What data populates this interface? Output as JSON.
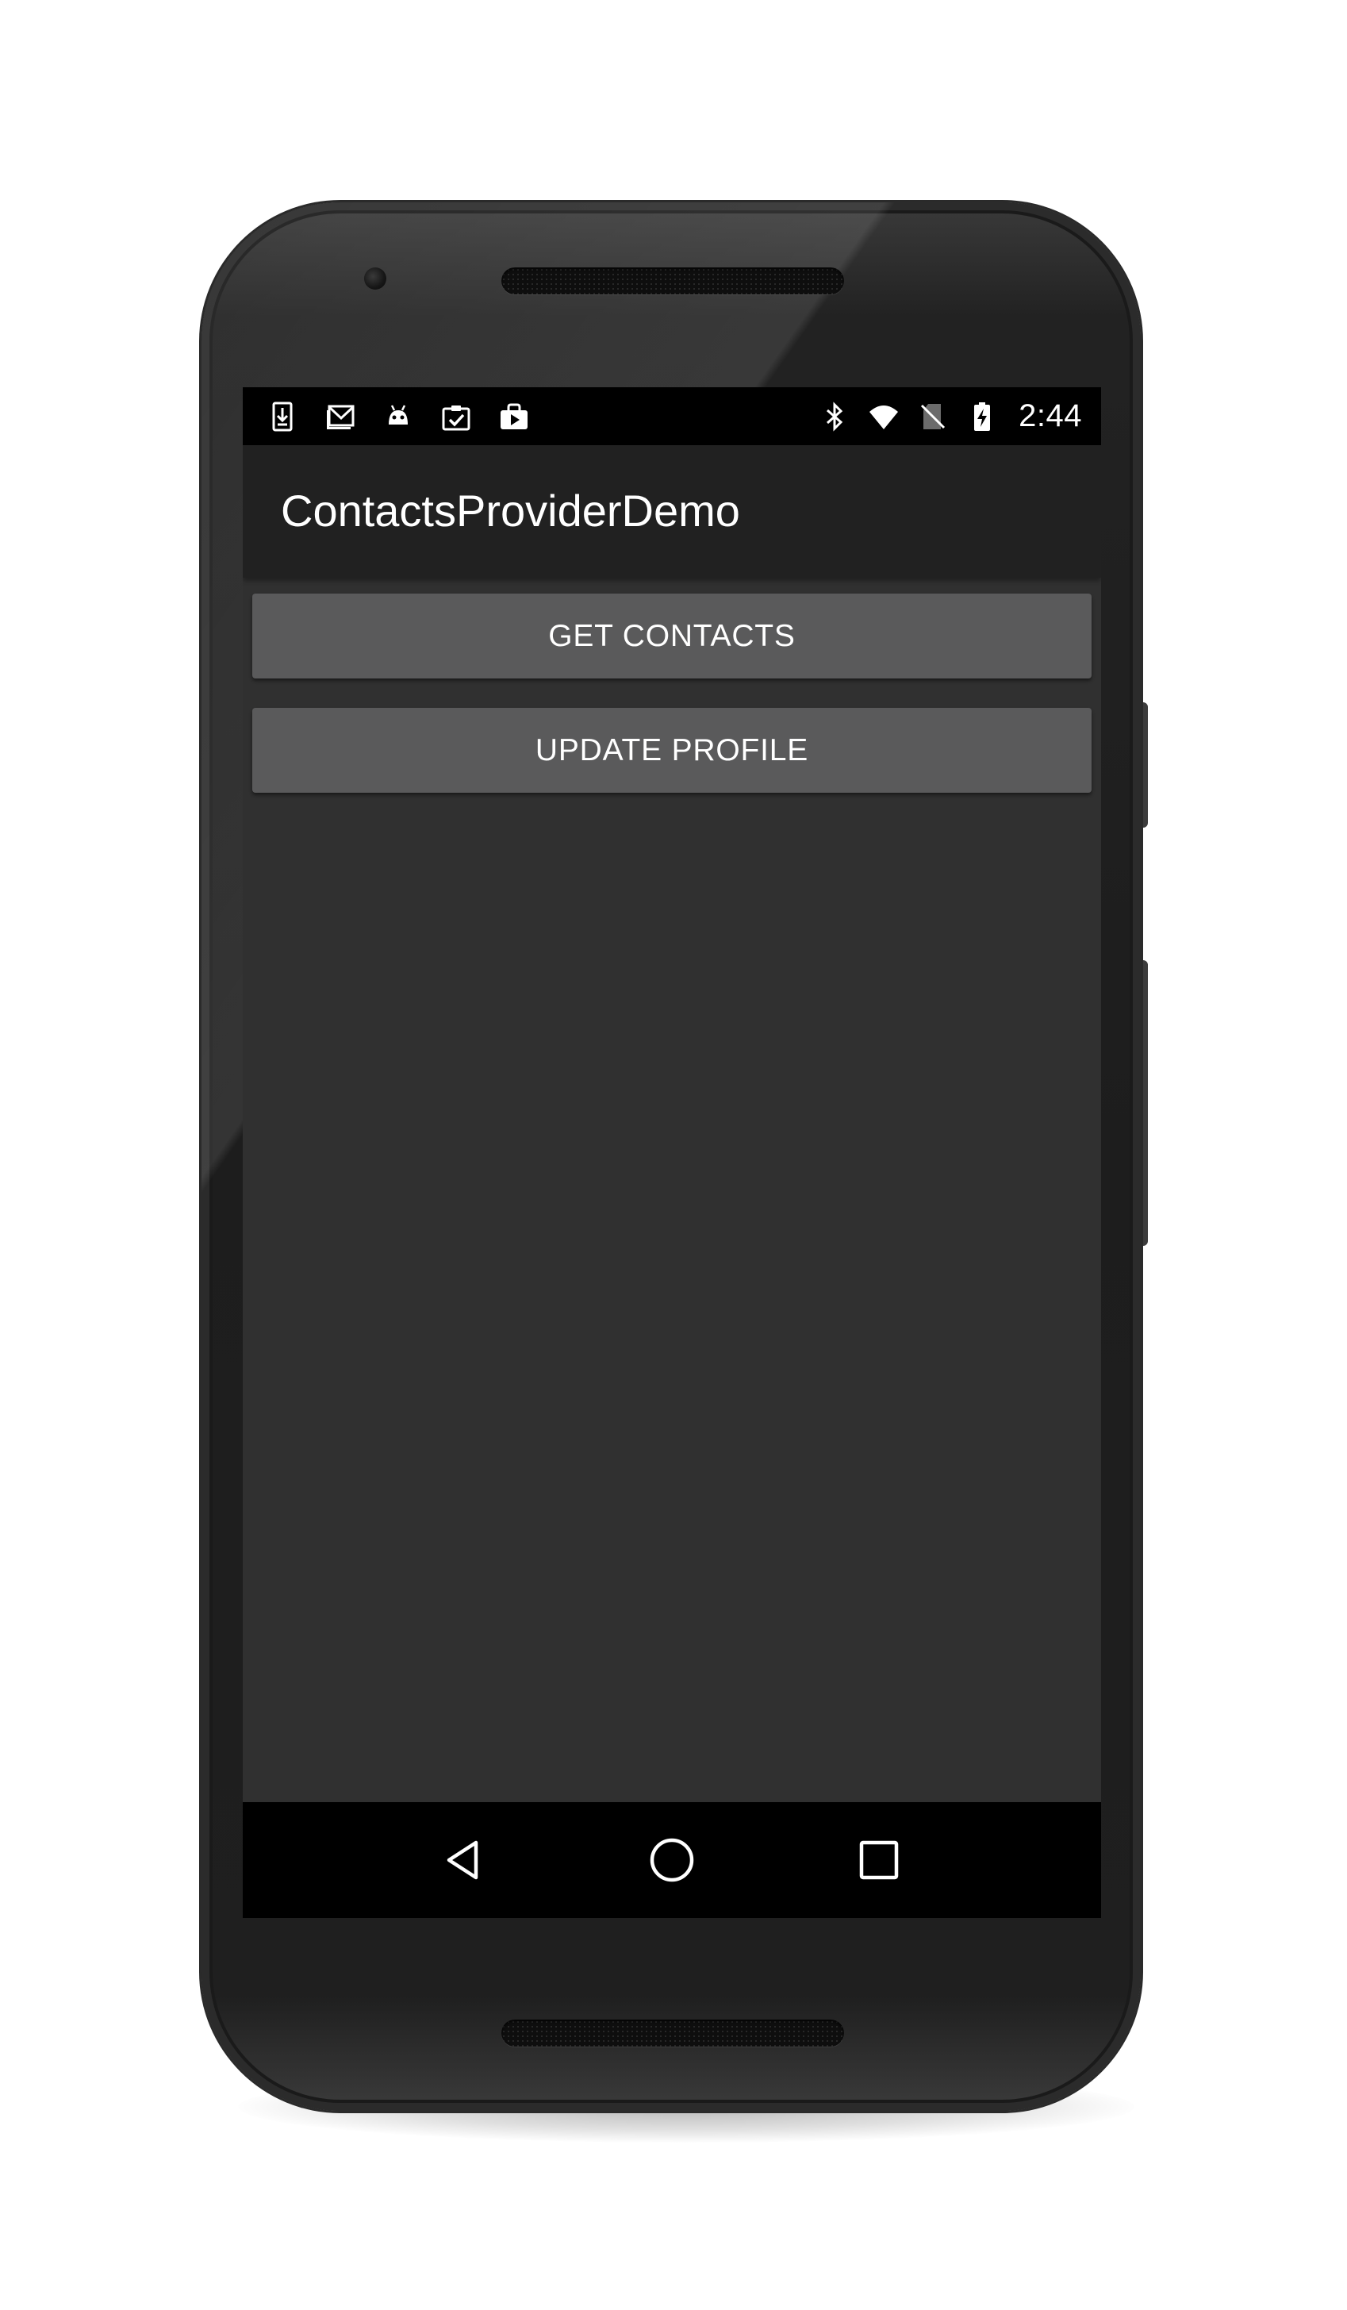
{
  "status_bar": {
    "notification_icons": [
      "download-icon",
      "gmail-icon",
      "android-icon",
      "clipboard-check-icon",
      "play-store-icon"
    ],
    "system_icons": [
      "bluetooth-icon",
      "wifi-icon",
      "no-sim-icon",
      "battery-charging-icon"
    ],
    "time": "2:44"
  },
  "action_bar": {
    "title": "ContactsProviderDemo"
  },
  "main": {
    "buttons": [
      {
        "label": "GET CONTACTS"
      },
      {
        "label": "UPDATE PROFILE"
      }
    ]
  },
  "nav_bar": {
    "buttons": [
      "back-icon",
      "home-icon",
      "recents-icon"
    ]
  },
  "colors": {
    "screen_background": "#303030",
    "action_bar": "#212121",
    "button": "#5a5a5b",
    "status_bar": "#000000",
    "text": "#ffffff"
  }
}
